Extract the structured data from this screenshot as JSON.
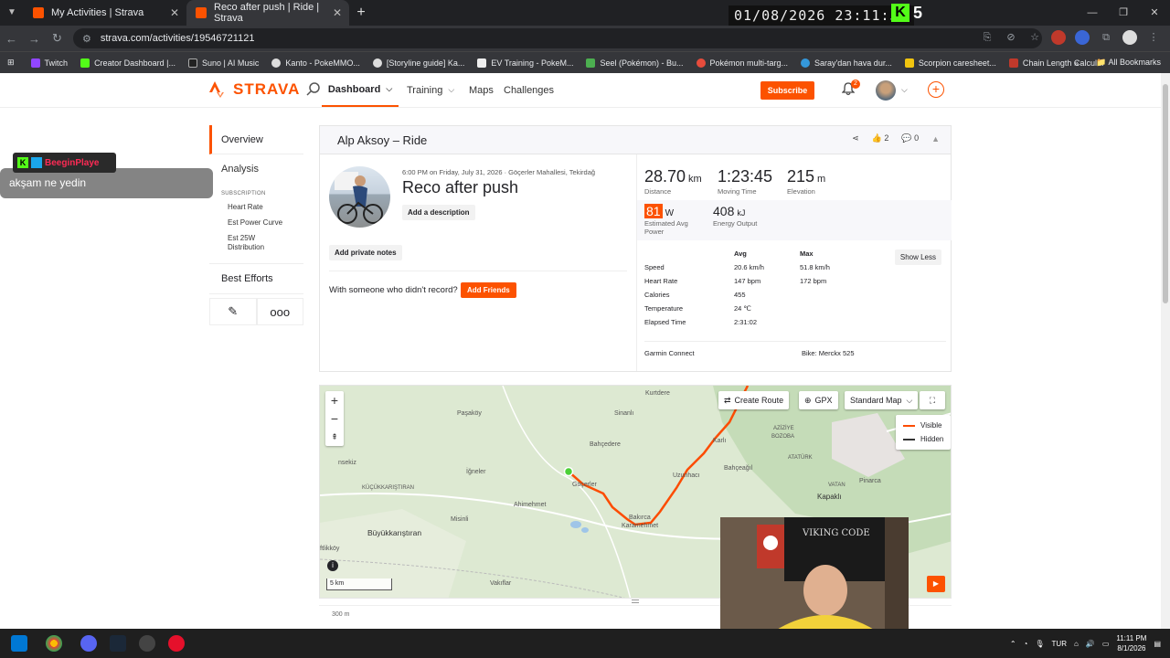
{
  "browser": {
    "tabs": [
      {
        "title": "My Activities | Strava",
        "active": false
      },
      {
        "title": "Reco after push | Ride | Strava",
        "active": true
      }
    ],
    "url": "strava.com/activities/19546721121",
    "bookmarks": [
      "Twitch",
      "Creator Dashboard |...",
      "Suno | AI Music",
      "Kanto - PokeMMO...",
      "[Storyline guide] Ka...",
      "EV Training - PokeM...",
      "Seel (Pokémon) - Bu...",
      "Pokémon multi-targ...",
      "Saray'dan hava dur...",
      "Scorpion caresheet...",
      "Chain Length Calcul..."
    ],
    "all_bookmarks": "All Bookmarks"
  },
  "overlay": {
    "clock": "01/08/2026 23:11:50",
    "kick_count": "5",
    "chat_username": "BeeginPlaye",
    "chat_message": "akşam ne yedin"
  },
  "header": {
    "logo": "STRAVA",
    "nav": [
      "Dashboard",
      "Training",
      "Maps",
      "Challenges"
    ],
    "subscribe": "Subscribe",
    "notifications": "2"
  },
  "sidebar": {
    "overview": "Overview",
    "analysis": "Analysis",
    "subscription_label": "SUBSCRIPTION",
    "sub_items": [
      "Heart Rate",
      "Est Power Curve",
      "Est 25W Distribution"
    ],
    "best_efforts": "Best Efforts"
  },
  "activity": {
    "header_title": "Alp Aksoy – Ride",
    "kudos": "2",
    "comments": "0",
    "meta": "6:00 PM on Friday, July 31, 2026 · Göçerler Mahallesi, Tekirdağ",
    "title": "Reco after push",
    "add_description": "Add a description",
    "add_private_notes": "Add private notes",
    "with_someone": "With someone who didn't record?",
    "add_friends": "Add Friends",
    "stats": {
      "distance": {
        "value": "28.70",
        "unit": "km",
        "label": "Distance"
      },
      "moving_time": {
        "value": "1:23:45",
        "label": "Moving Time"
      },
      "elevation": {
        "value": "215",
        "unit": "m",
        "label": "Elevation"
      },
      "power": {
        "value": "81",
        "unit": "W",
        "label": "Estimated Avg Power"
      },
      "energy": {
        "value": "408",
        "unit": "kJ",
        "label": "Energy Output"
      }
    },
    "table": {
      "col_avg": "Avg",
      "col_max": "Max",
      "show_less": "Show Less",
      "rows": [
        {
          "label": "Speed",
          "avg": "20.6 km/h",
          "max": "51.8 km/h"
        },
        {
          "label": "Heart Rate",
          "avg": "147 bpm",
          "max": "172 bpm"
        },
        {
          "label": "Calories",
          "avg": "455",
          "max": ""
        },
        {
          "label": "Temperature",
          "avg": "24 ℃",
          "max": ""
        },
        {
          "label": "Elapsed Time",
          "avg": "2:31:02",
          "max": ""
        }
      ]
    },
    "device": "Garmin Connect",
    "bike": "Bike: Merckx 525"
  },
  "map": {
    "create_route": "Create Route",
    "gpx": "GPX",
    "map_type": "Standard Map",
    "legend_visible": "Visible",
    "legend_hidden": "Hidden",
    "scale": "5 km",
    "places": [
      "Kurtdere",
      "Paşaköy",
      "Sinanlı",
      "Bahçedere",
      "İğneler",
      "Göçerler",
      "Ahimehmet",
      "Misinli",
      "Bakırca",
      "Karamehmet",
      "Uzunhacı",
      "Bahçeağıl",
      "Karlı",
      "AZİZİYE",
      "BOZOBA",
      "ATATÜRK",
      "VATAN",
      "Pinarca",
      "Kapaklı",
      "KÜÇÜKKARIŞTIRAN",
      "Büyükkarıştıran",
      "Vakıflar",
      "nsekiz",
      "ftlikköy"
    ],
    "elevation_label": "300 m",
    "route_color": "#fc4c02",
    "hidden_color": "#333333"
  },
  "taskbar": {
    "lang": "TUR",
    "time": "11:11 PM",
    "date": "8/1/2026"
  }
}
